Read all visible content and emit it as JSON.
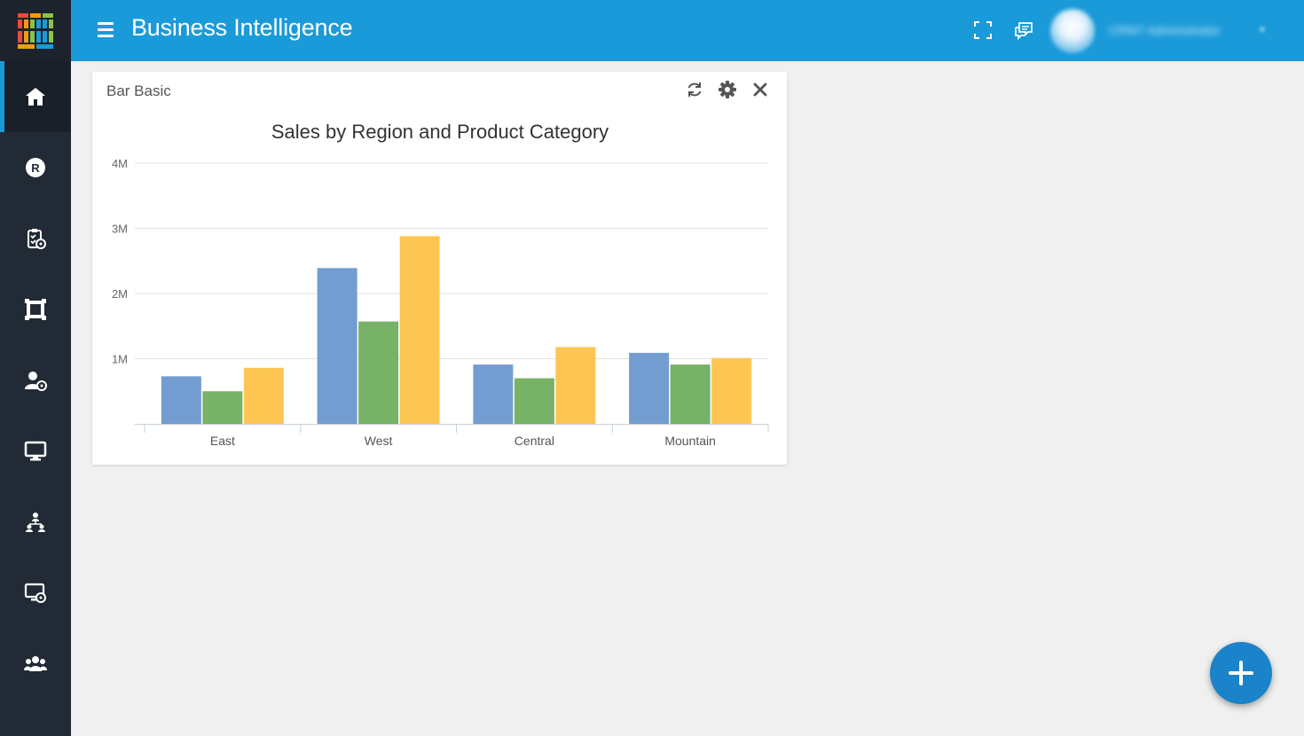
{
  "header": {
    "title": "Business Intelligence",
    "user_name": "CRM7 Administrator"
  },
  "sidebar": {
    "items": [
      {
        "icon": "home-icon",
        "active": true
      },
      {
        "icon": "r-badge-icon",
        "active": false
      },
      {
        "icon": "clipboard-gear-icon",
        "active": false
      },
      {
        "icon": "frame-icon",
        "active": false
      },
      {
        "icon": "user-gear-icon",
        "active": false
      },
      {
        "icon": "monitor-icon",
        "active": false
      },
      {
        "icon": "org-chart-icon",
        "active": false
      },
      {
        "icon": "screen-gear-icon",
        "active": false
      },
      {
        "icon": "users-group-icon",
        "active": false
      }
    ]
  },
  "widget": {
    "title": "Bar Basic"
  },
  "colors": {
    "accent": "#1a9ad9",
    "sidebar": "#222b35",
    "series": [
      "#739cd1",
      "#77b266",
      "#fdc652"
    ]
  },
  "chart_data": {
    "type": "bar",
    "title": "Sales by Region and Product Category",
    "categories": [
      "East",
      "West",
      "Central",
      "Mountain"
    ],
    "series": [
      {
        "values": [
          730000,
          2390000,
          910000,
          1090000
        ]
      },
      {
        "values": [
          500000,
          1570000,
          700000,
          910000
        ]
      },
      {
        "values": [
          860000,
          2880000,
          1180000,
          1010000
        ]
      }
    ],
    "ylim": [
      0,
      4000000
    ],
    "yticks": [
      {
        "value": 1000000,
        "label": "1M"
      },
      {
        "value": 2000000,
        "label": "2M"
      },
      {
        "value": 3000000,
        "label": "3M"
      },
      {
        "value": 4000000,
        "label": "4M"
      }
    ],
    "grid": true,
    "legend": "none"
  }
}
